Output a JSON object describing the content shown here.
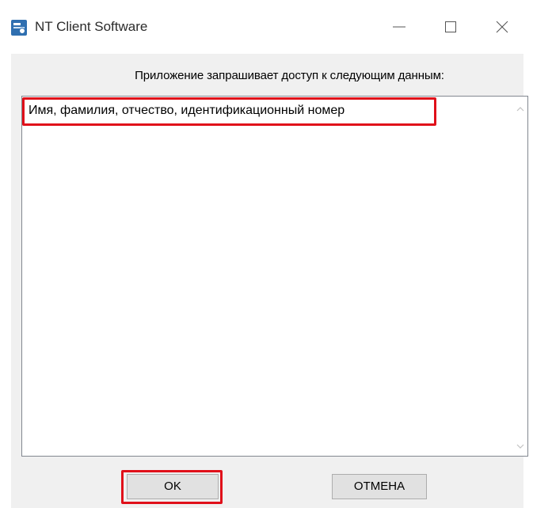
{
  "window": {
    "title": "NT Client Software",
    "icon": "app-icon"
  },
  "controls": {
    "minimize_icon": "minimize-icon",
    "maximize_icon": "maximize-icon",
    "close_icon": "close-icon"
  },
  "dialog": {
    "prompt": "Приложение запрашивает доступ к следующим данным:",
    "items": [
      "Имя, фамилия, отчество, идентификационный номер"
    ],
    "ok_label": "OK",
    "cancel_label": "ОТМЕНА"
  },
  "colors": {
    "highlight": "#e0101a",
    "dialog_background": "#f0f0f0",
    "button_face": "#e1e1e1"
  }
}
